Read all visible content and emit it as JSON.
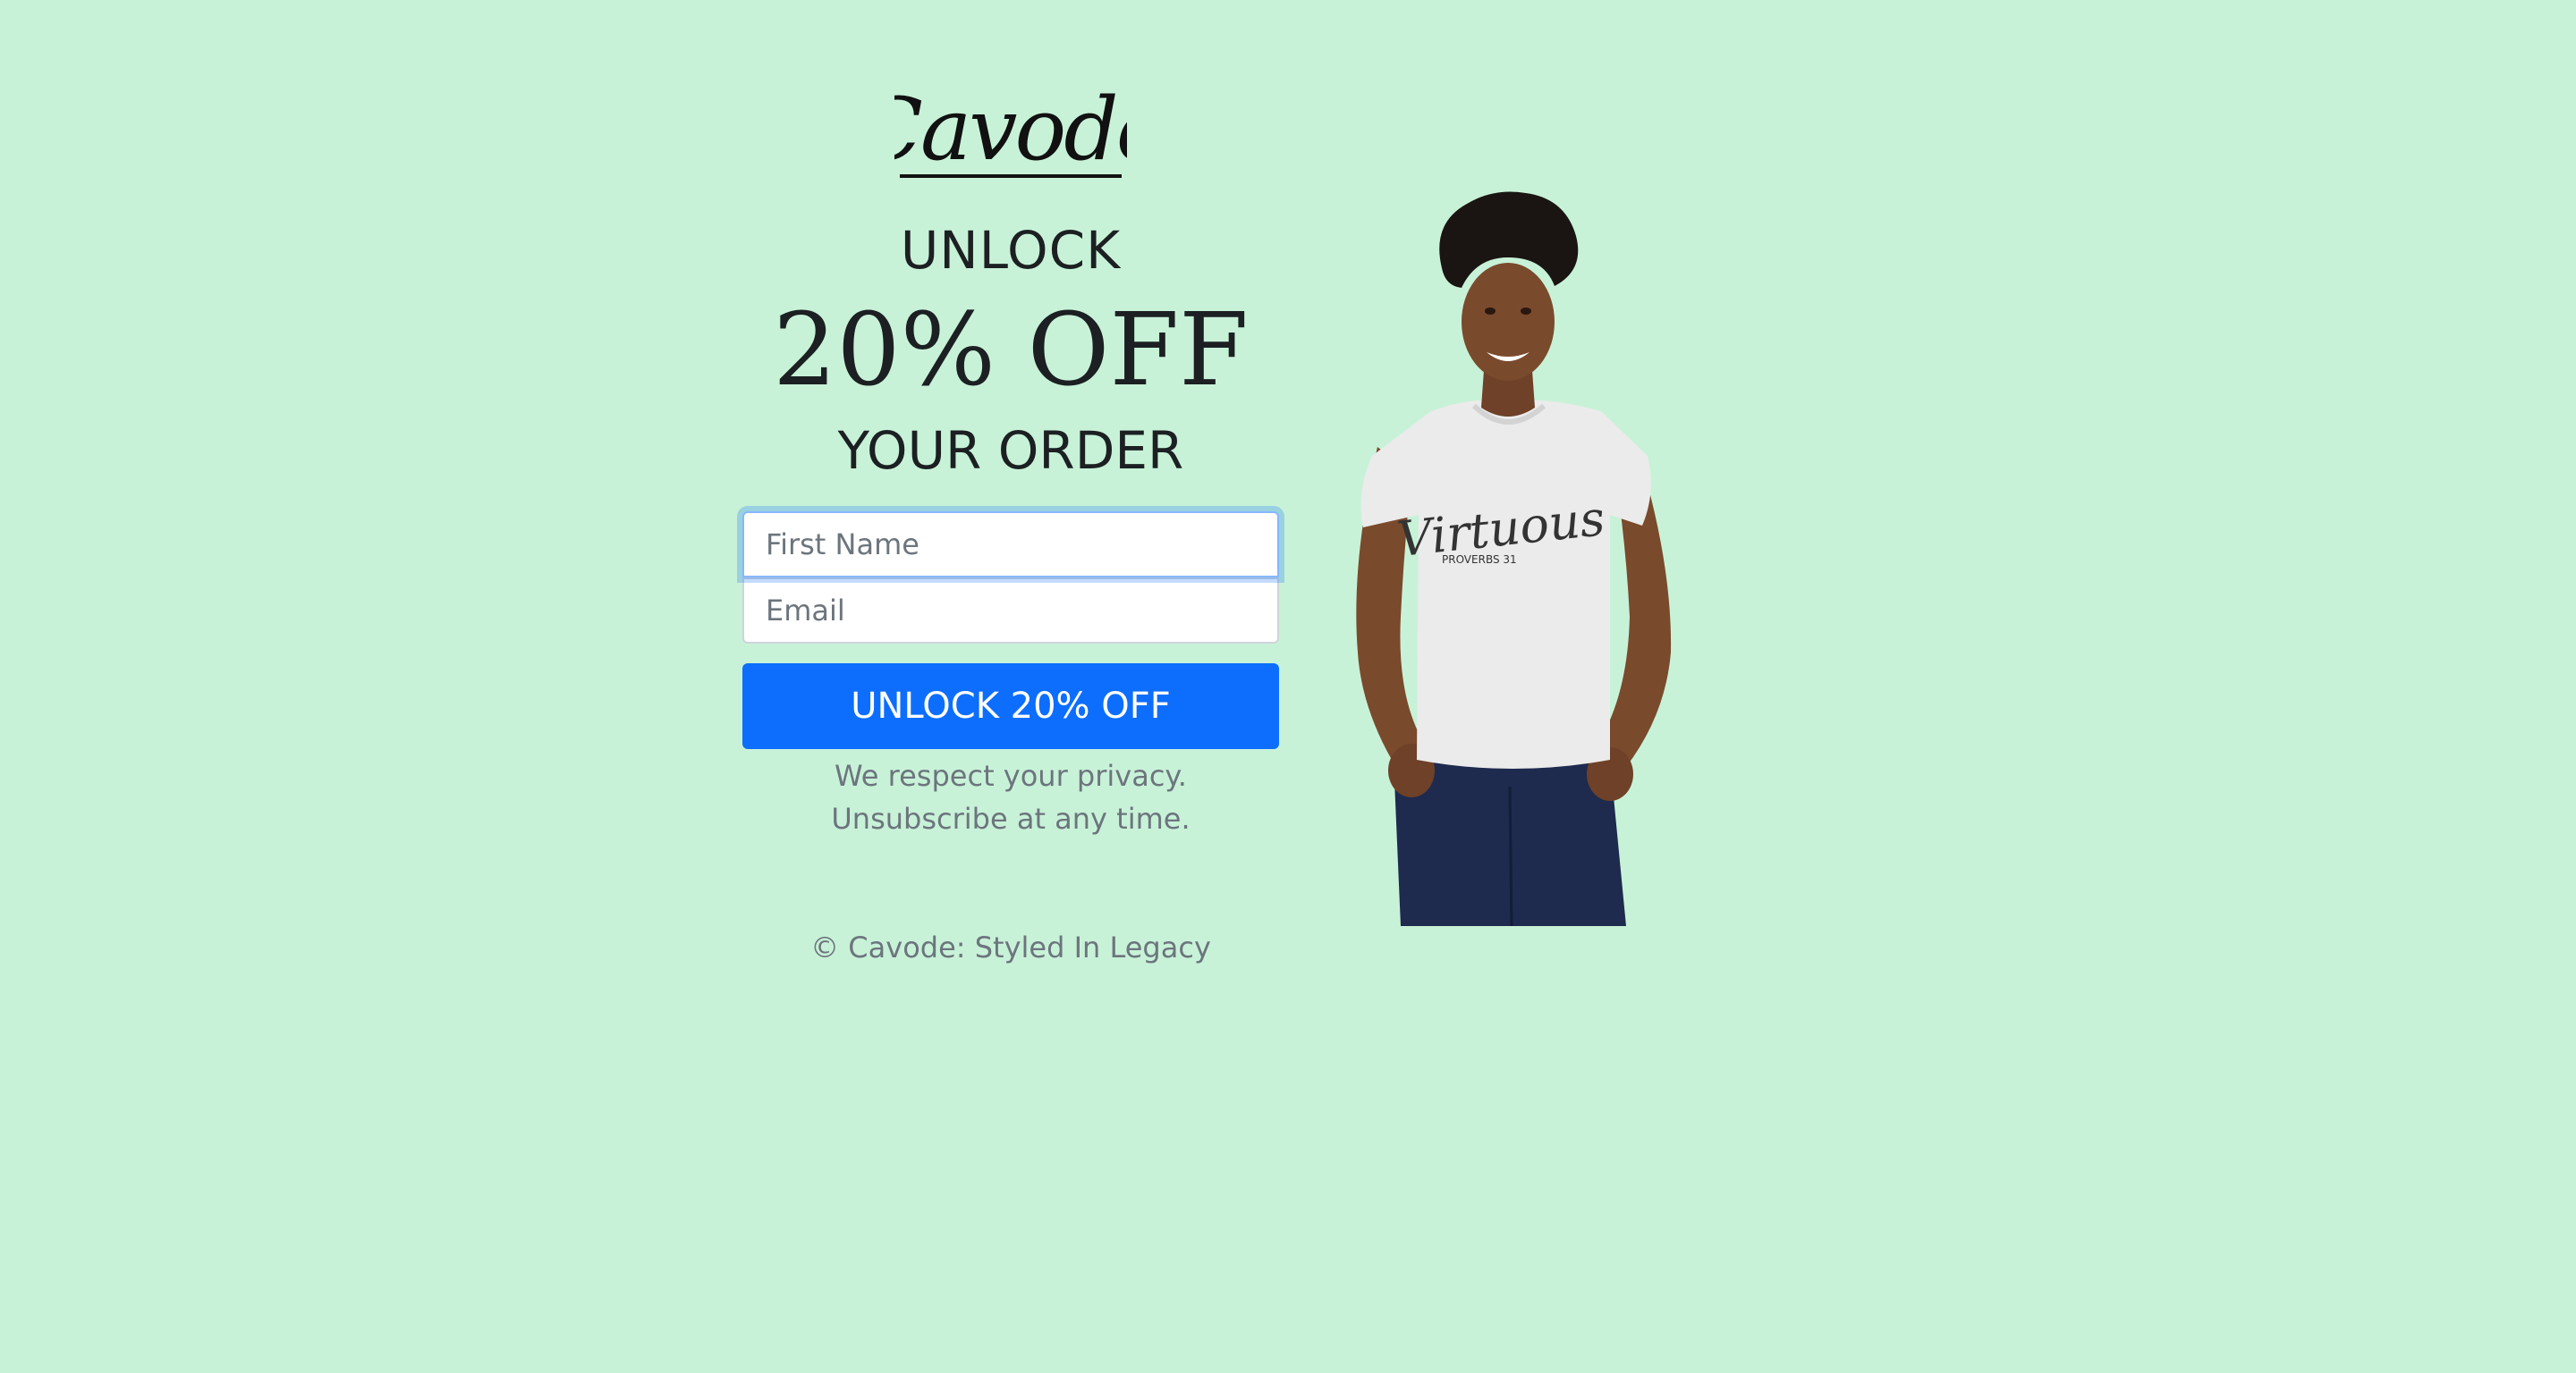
{
  "brand": {
    "logo_text": "Cavode"
  },
  "hero": {
    "line1": "UNLOCK",
    "line2": "20% OFF",
    "line3": "YOUR ORDER"
  },
  "form": {
    "first_name_placeholder": "First Name",
    "first_name_value": "",
    "email_placeholder": "Email",
    "email_value": "",
    "submit_label": "UNLOCK 20% OFF"
  },
  "privacy": {
    "line1": "We respect your privacy.",
    "line2": "Unsubscribe at any time."
  },
  "footer": {
    "copyright": "© Cavode: Styled In Legacy"
  },
  "product_image": {
    "shirt_text": "Virtuous",
    "shirt_subtext": "PROVERBS 31"
  },
  "colors": {
    "background": "#c8f2d8",
    "button": "#0d6efd",
    "muted_text": "#6c757d"
  }
}
